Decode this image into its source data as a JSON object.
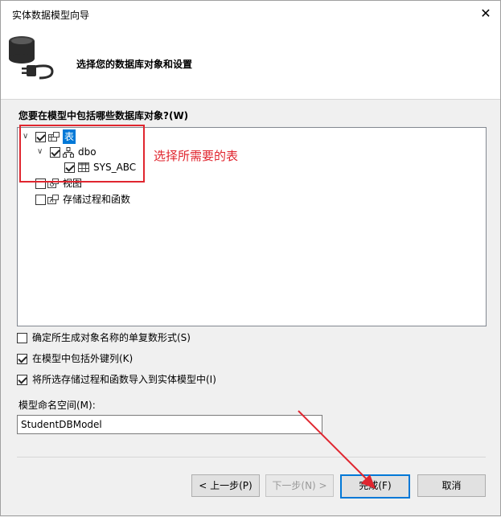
{
  "window": {
    "title": "实体数据模型向导",
    "close_glyph": "✕"
  },
  "header": {
    "title": "选择您的数据库对象和设置",
    "icon": "database-plug-icon"
  },
  "tree": {
    "question": "您要在模型中包括哪些数据库对象?(W)",
    "nodes": {
      "tables": {
        "label": "表",
        "checked": true,
        "expanded": true
      },
      "dbo": {
        "label": "dbo",
        "checked": true,
        "expanded": true
      },
      "sys_abc": {
        "label": "SYS_ABC",
        "checked": true
      },
      "views": {
        "label": "视图",
        "checked": false
      },
      "procs": {
        "label": "存储过程和函数",
        "checked": false
      }
    }
  },
  "annotation": {
    "text": "选择所需要的表",
    "color": "#e0262f"
  },
  "options": {
    "pluralize": {
      "label": "确定所生成对象名称的单复数形式(S)",
      "checked": false
    },
    "foreign_keys": {
      "label": "在模型中包括外键列(K)",
      "checked": true
    },
    "import_procs": {
      "label": "将所选存储过程和函数导入到实体模型中(I)",
      "checked": true
    }
  },
  "namespace": {
    "label": "模型命名空间(M):",
    "value": "StudentDBModel"
  },
  "buttons": {
    "previous": "< 上一步(P)",
    "next": "下一步(N) >",
    "finish": "完成(F)",
    "cancel": "取消"
  }
}
